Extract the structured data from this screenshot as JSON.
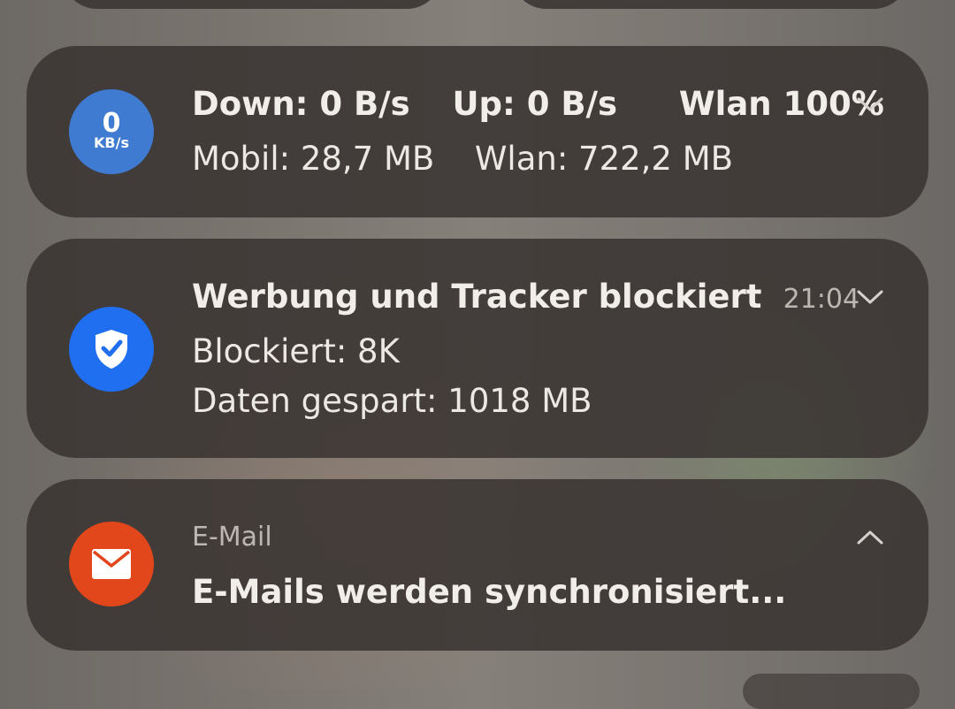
{
  "colors": {
    "speed_icon_bg": "#3f7bd1",
    "blocker_icon_bg": "#1f6ff0",
    "email_icon_bg": "#e2471c",
    "card_bg": "rgba(58,52,50,0.88)",
    "text_primary": "#f1ede9",
    "text_secondary": "#bdb7b2"
  },
  "notifications": [
    {
      "app_icon": "speed-meter-icon",
      "icon_value": "0",
      "icon_unit": "KB/s",
      "down": "Down: 0 B/s",
      "up": "Up: 0 B/s",
      "wifi_signal": "Wlan 100%",
      "mobile_usage": "Mobil: 28,7 MB",
      "wifi_usage": "Wlan: 722,2 MB",
      "expand_icon": "chevron-down-icon"
    },
    {
      "app_icon": "shield-check-icon",
      "title": "Werbung und Tracker blockiert",
      "time": "21:04",
      "blocked": "Blockiert: 8K",
      "data_saved": "Daten gespart: 1018 MB",
      "expand_icon": "chevron-down-icon"
    },
    {
      "app_icon": "mail-icon",
      "app_name": "E-Mail",
      "message": "E-Mails werden synchronisiert...",
      "expand_icon": "chevron-up-icon"
    }
  ]
}
